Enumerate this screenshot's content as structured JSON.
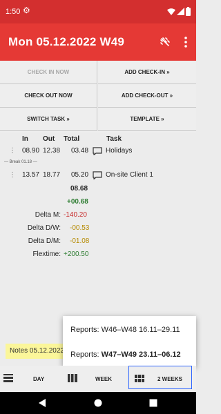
{
  "status_bar": {
    "time": "1:50"
  },
  "app_bar": {
    "title": "Mon 05.12.2022 W49"
  },
  "actions": {
    "check_in_now": "CHECK IN NOW",
    "add_check_in": "ADD CHECK-IN »",
    "check_out_now": "CHECK OUT NOW",
    "add_check_out": "ADD CHECK-OUT »",
    "switch_task": "SWITCH TASK »",
    "template": "TEMPLATE »"
  },
  "table": {
    "headers": {
      "in": "In",
      "out": "Out",
      "total": "Total",
      "task": "Task"
    },
    "rows": [
      {
        "in": "08.90",
        "out": "12.38",
        "total": "03.48",
        "task": "Holidays"
      },
      {
        "in": "13.57",
        "out": "18.77",
        "total": "05.20",
        "task": "On-site Client 1"
      }
    ],
    "break_label": "— Break 01.18 —",
    "day_total": "08.68",
    "day_delta": "+00.68"
  },
  "summary": [
    {
      "label": "Delta M:",
      "value": "-140.20"
    },
    {
      "label": "Delta D/W:",
      "value": "-00.53"
    },
    {
      "label": "Delta D/M:",
      "value": "-01.08"
    },
    {
      "label": "Flextime:",
      "value": "+200.50"
    }
  ],
  "notes": {
    "text": "Notes 05.12.2022"
  },
  "reports_menu": {
    "item1": "Reports: W46–W48 16.11–29.11",
    "item2_prefix": "Reports: ",
    "item2_bold": "W47–W49 23.11–06.12"
  },
  "bottom_nav": {
    "day": "DAY",
    "week": "WEEK",
    "two_weeks": "2 WEEKS"
  },
  "colors": {
    "primary": "#e53935",
    "status": "#d32f2f",
    "positive": "#2e7d32",
    "negative": "#c62828",
    "warning": "#b58a00",
    "selection": "#2962ff"
  }
}
